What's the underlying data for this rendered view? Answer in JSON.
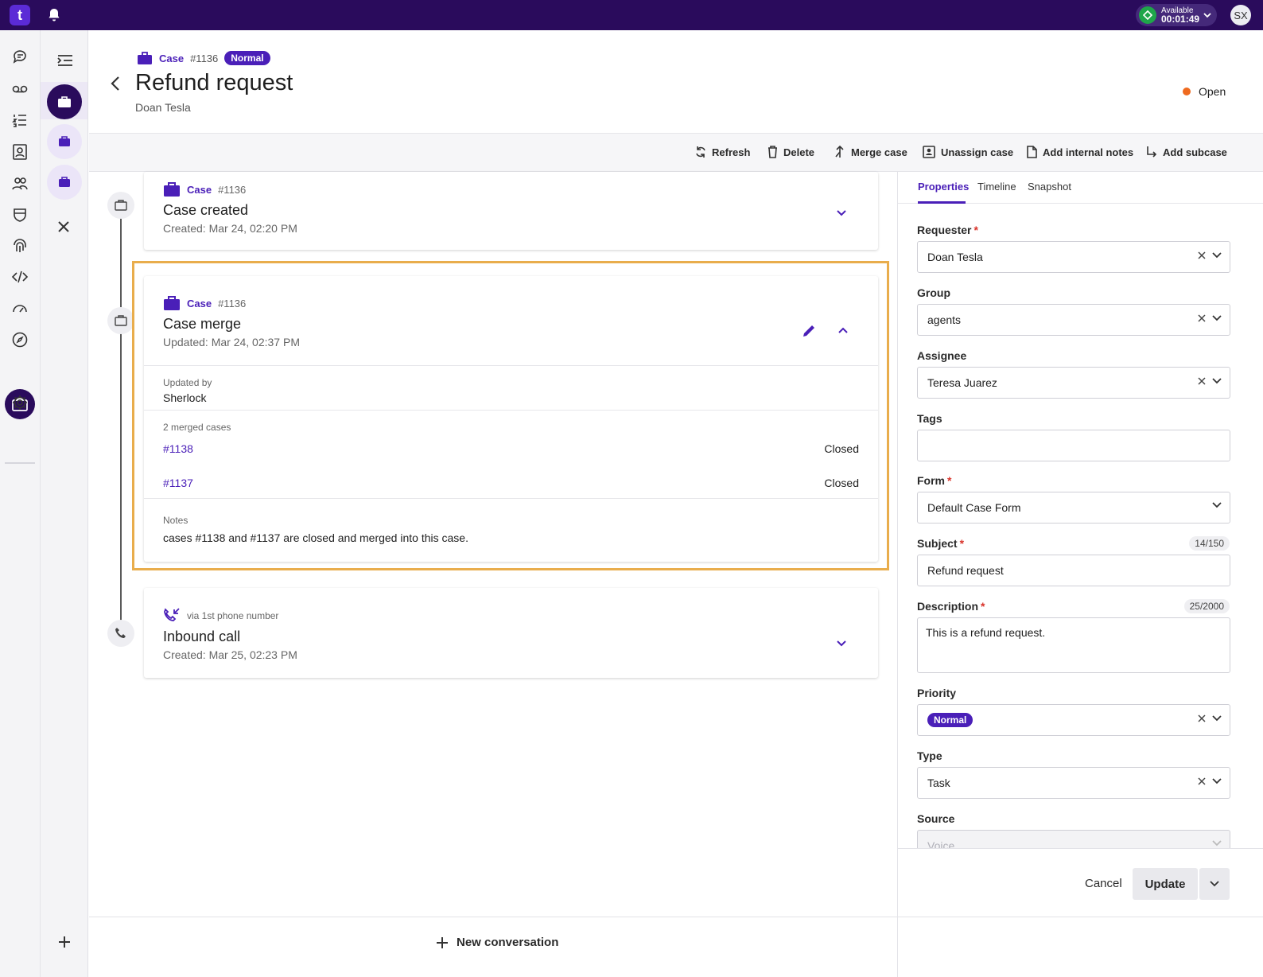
{
  "topbar": {
    "logo_text": "t",
    "status_label": "Available",
    "status_time": "00:01:49",
    "avatar_initials": "SX"
  },
  "header": {
    "type_label": "Case",
    "case_id": "#1136",
    "priority_badge": "Normal",
    "title": "Refund request",
    "requester": "Doan Tesla",
    "status": "Open",
    "status_color": "#ef6a1f"
  },
  "toolbar": {
    "refresh": "Refresh",
    "delete": "Delete",
    "merge": "Merge case",
    "unassign": "Unassign case",
    "notes": "Add internal notes",
    "subcase": "Add subcase"
  },
  "timeline": {
    "created": {
      "type_label": "Case",
      "case_id": "#1136",
      "title": "Case created",
      "date": "Created: Mar 24, 02:20 PM"
    },
    "merge": {
      "type_label": "Case",
      "case_id": "#1136",
      "title": "Case merge",
      "date": "Updated: Mar 24, 02:37 PM",
      "updated_by_label": "Updated by",
      "updated_by": "Sherlock",
      "merged_label": "2 merged cases",
      "merged": [
        {
          "id": "#1138",
          "status": "Closed"
        },
        {
          "id": "#1137",
          "status": "Closed"
        }
      ],
      "notes_label": "Notes",
      "notes": "cases #1138 and #1137 are closed and merged into this case."
    },
    "call": {
      "via": "via 1st phone number",
      "title": "Inbound call",
      "date": "Created: Mar 25, 02:23 PM"
    }
  },
  "bottom": {
    "new_conversation": "New conversation"
  },
  "panel": {
    "tabs": [
      "Properties",
      "Timeline",
      "Snapshot"
    ],
    "requester_label": "Requester",
    "requester_value": "Doan Tesla",
    "group_label": "Group",
    "group_value": "agents",
    "assignee_label": "Assignee",
    "assignee_value": "Teresa Juarez",
    "tags_label": "Tags",
    "form_label": "Form",
    "form_value": "Default Case Form",
    "subject_label": "Subject",
    "subject_counter": "14/150",
    "subject_value": "Refund request",
    "description_label": "Description",
    "description_counter": "25/2000",
    "description_value": "This is a refund request.",
    "priority_label": "Priority",
    "priority_value": "Normal",
    "type_label": "Type",
    "type_value": "Task",
    "source_label": "Source",
    "source_value": "Voice",
    "cancel": "Cancel",
    "update": "Update",
    "required_mark": "*"
  },
  "colors": {
    "brand": "#2a0b5c",
    "accent": "#4a1fb8",
    "highlight": "#e9ad4c"
  }
}
